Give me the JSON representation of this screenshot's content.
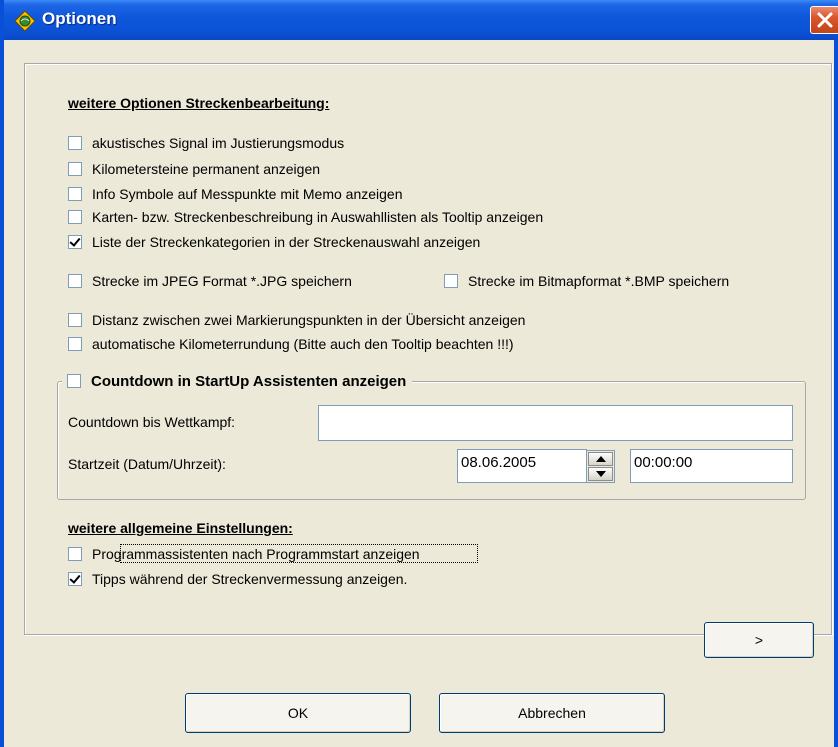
{
  "window": {
    "title": "Optionen"
  },
  "section_track": {
    "heading": "weitere Optionen Streckenbearbeitung:",
    "options": [
      {
        "label": "akustisches Signal im Justierungsmodus",
        "checked": false
      },
      {
        "label": "Kilometersteine permanent anzeigen",
        "checked": false
      },
      {
        "label": "Info Symbole auf Messpunkte mit Memo anzeigen",
        "checked": false
      },
      {
        "label": "Karten- bzw. Streckenbeschreibung in Auswahllisten als Tooltip anzeigen",
        "checked": false
      },
      {
        "label": "Liste der Streckenkategorien in der Streckenauswahl anzeigen",
        "checked": true
      }
    ],
    "save_jpeg": {
      "label": "Strecke im JPEG Format *.JPG speichern",
      "checked": false
    },
    "save_bmp": {
      "label": "Strecke im Bitmapformat *.BMP speichern",
      "checked": false
    },
    "distance": {
      "label": "Distanz zwischen zwei Markierungspunkten in der Übersicht anzeigen",
      "checked": false
    },
    "km_rounding": {
      "label": "automatische Kilometerrundung (Bitte auch den Tooltip beachten !!!)",
      "checked": false
    }
  },
  "countdown": {
    "label": "Countdown in StartUp Assistenten anzeigen",
    "checked": false,
    "until_label": "Countdown bis Wettkampf:",
    "until_value": "",
    "start_label": "Startzeit (Datum/Uhrzeit):",
    "date_value": "08.06.2005",
    "time_value": "00:00:00"
  },
  "section_general": {
    "heading": "weitere allgemeine Einstellungen:",
    "assistants": {
      "label": "Programmassistenten nach Programmstart anzeigen",
      "checked": false
    },
    "tips": {
      "label": "Tipps während der Streckenvermessung anzeigen.",
      "checked": true
    }
  },
  "buttons": {
    "next": ">",
    "ok": "OK",
    "cancel": "Abbrechen"
  },
  "icons": {
    "app": "globe-diamond-icon",
    "close": "close-icon",
    "spin_up": "arrow-up-icon",
    "spin_down": "arrow-down-icon"
  },
  "colors": {
    "titlebar": "#0b51d6",
    "close": "#d9572c",
    "face": "#ece9d8"
  }
}
